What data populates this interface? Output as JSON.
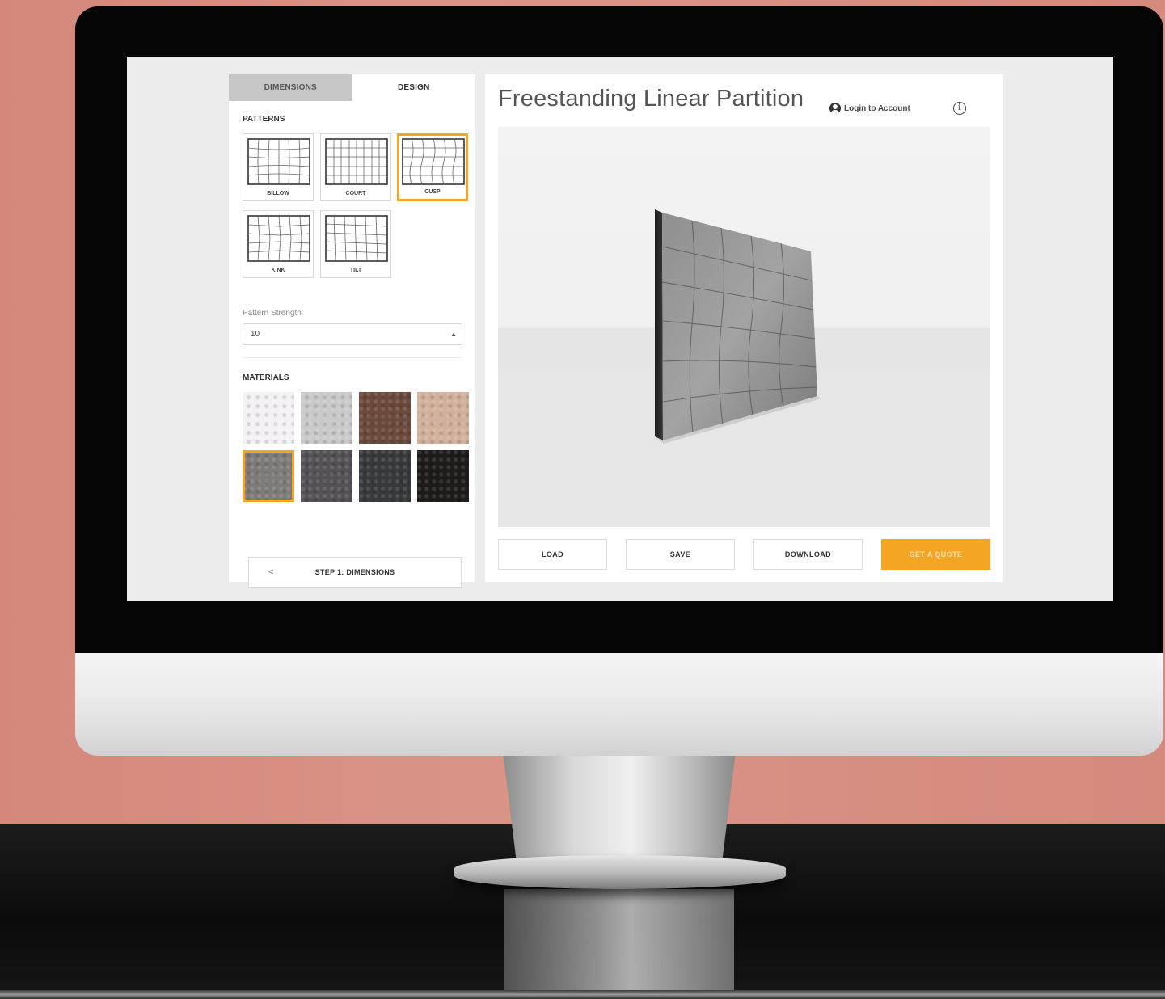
{
  "tabs": [
    {
      "label": "DIMENSIONS",
      "active": false
    },
    {
      "label": "DESIGN",
      "active": true
    }
  ],
  "patterns": {
    "title": "PATTERNS",
    "items": [
      {
        "label": "BILLOW",
        "selected": false
      },
      {
        "label": "COURT",
        "selected": false
      },
      {
        "label": "CUSP",
        "selected": true
      },
      {
        "label": "KINK",
        "selected": false
      },
      {
        "label": "TILT",
        "selected": false
      }
    ]
  },
  "pattern_strength": {
    "label": "Pattern Strength",
    "value": "10"
  },
  "materials": {
    "title": "MATERIALS",
    "swatches": [
      {
        "name": "white",
        "color": "#f3f1f4",
        "selected": false
      },
      {
        "name": "light-gray-speckle",
        "color": "#c9c9c9",
        "selected": false
      },
      {
        "name": "brown",
        "color": "#6b4a3c",
        "selected": false
      },
      {
        "name": "beige",
        "color": "#d2b09c",
        "selected": false
      },
      {
        "name": "medium-gray",
        "color": "#7e7b78",
        "selected": true
      },
      {
        "name": "dark-gray",
        "color": "#545157",
        "selected": false
      },
      {
        "name": "charcoal-speckle",
        "color": "#38393a",
        "selected": false
      },
      {
        "name": "black",
        "color": "#1f1b1b",
        "selected": false
      }
    ]
  },
  "step_button": {
    "chevron": "<",
    "label": "STEP 1: DIMENSIONS"
  },
  "header": {
    "title": "Freestanding Linear Partition",
    "login_label": "Login to Account",
    "info_glyph": "i"
  },
  "actions": [
    {
      "label": "LOAD"
    },
    {
      "label": "SAVE"
    },
    {
      "label": "DOWNLOAD"
    },
    {
      "label": "GET A QUOTE"
    }
  ],
  "colors": {
    "accent": "#f5a524",
    "panel_bg": "#ffffff",
    "screen_bg": "#ececec"
  }
}
